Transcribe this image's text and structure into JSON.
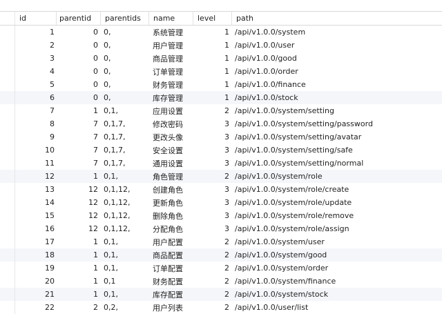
{
  "columns": {
    "id": "id",
    "parentid": "parentid",
    "parentids": "parentids",
    "name": "name",
    "level": "level",
    "path": "path"
  },
  "rows": [
    {
      "id": "1",
      "parentid": "0",
      "parentids": "0,",
      "name": "系统管理",
      "level": "1",
      "path": "/api/v1.0.0/system"
    },
    {
      "id": "2",
      "parentid": "0",
      "parentids": "0,",
      "name": "用户管理",
      "level": "1",
      "path": "/api/v1.0.0/user"
    },
    {
      "id": "3",
      "parentid": "0",
      "parentids": "0,",
      "name": "商品管理",
      "level": "1",
      "path": "/api/v1.0.0/good"
    },
    {
      "id": "4",
      "parentid": "0",
      "parentids": "0,",
      "name": "订单管理",
      "level": "1",
      "path": "/api/v1.0.0/order"
    },
    {
      "id": "5",
      "parentid": "0",
      "parentids": "0,",
      "name": "财务管理",
      "level": "1",
      "path": "/api/v1.0.0/finance"
    },
    {
      "id": "6",
      "parentid": "0",
      "parentids": "0,",
      "name": "库存管理",
      "level": "1",
      "path": "/api/v1.0.0/stock"
    },
    {
      "id": "7",
      "parentid": "1",
      "parentids": "0,1,",
      "name": "应用设置",
      "level": "2",
      "path": "/api/v1.0.0/system/setting"
    },
    {
      "id": "8",
      "parentid": "7",
      "parentids": "0,1,7,",
      "name": "修改密码",
      "level": "3",
      "path": "/api/v1.0.0/system/setting/password"
    },
    {
      "id": "9",
      "parentid": "7",
      "parentids": "0,1,7,",
      "name": "更改头像",
      "level": "3",
      "path": "/api/v1.0.0/system/setting/avatar"
    },
    {
      "id": "10",
      "parentid": "7",
      "parentids": "0,1,7,",
      "name": "安全设置",
      "level": "3",
      "path": "/api/v1.0.0/system/setting/safe"
    },
    {
      "id": "11",
      "parentid": "7",
      "parentids": "0,1,7,",
      "name": "通用设置",
      "level": "3",
      "path": "/api/v1.0.0/system/setting/normal"
    },
    {
      "id": "12",
      "parentid": "1",
      "parentids": "0,1,",
      "name": "角色管理",
      "level": "2",
      "path": "/api/v1.0.0/system/role"
    },
    {
      "id": "13",
      "parentid": "12",
      "parentids": "0,1,12,",
      "name": "创建角色",
      "level": "3",
      "path": "/api/v1.0.0/system/role/create"
    },
    {
      "id": "14",
      "parentid": "12",
      "parentids": "0,1,12,",
      "name": "更新角色",
      "level": "3",
      "path": "/api/v1.0.0/system/role/update"
    },
    {
      "id": "15",
      "parentid": "12",
      "parentids": "0,1,12,",
      "name": "删除角色",
      "level": "3",
      "path": "/api/v1.0.0/system/role/remove"
    },
    {
      "id": "16",
      "parentid": "12",
      "parentids": "0,1,12,",
      "name": "分配角色",
      "level": "3",
      "path": "/api/v1.0.0/system/role/assign"
    },
    {
      "id": "17",
      "parentid": "1",
      "parentids": "0,1,",
      "name": "用户配置",
      "level": "2",
      "path": "/api/v1.0.0/system/user"
    },
    {
      "id": "18",
      "parentid": "1",
      "parentids": "0,1,",
      "name": "商品配置",
      "level": "2",
      "path": "/api/v1.0.0/system/good"
    },
    {
      "id": "19",
      "parentid": "1",
      "parentids": "0,1,",
      "name": "订单配置",
      "level": "2",
      "path": "/api/v1.0.0/system/order"
    },
    {
      "id": "20",
      "parentid": "1",
      "parentids": "0,1",
      "name": "财务配置",
      "level": "2",
      "path": "/api/v1.0.0/system/finance"
    },
    {
      "id": "21",
      "parentid": "1",
      "parentids": "0,1,",
      "name": "库存配置",
      "level": "2",
      "path": "/api/v1.0.0/system/stock"
    },
    {
      "id": "22",
      "parentid": "2",
      "parentids": "0,2,",
      "name": "用户列表",
      "level": "2",
      "path": "/api/v1.0.0/user/list"
    }
  ],
  "colors": {
    "alt_row": "#f4f6fa",
    "grid_line": "#e6e6e6",
    "header_border": "#d8d8d8"
  }
}
